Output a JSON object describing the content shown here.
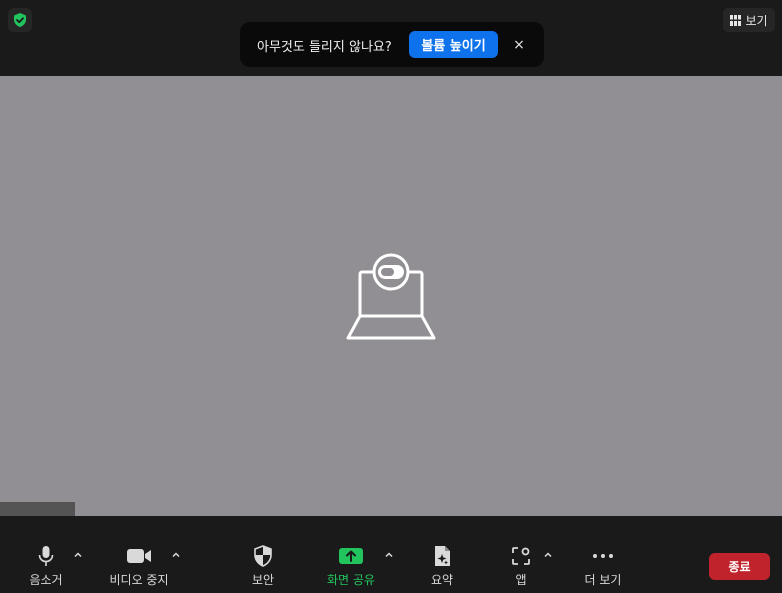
{
  "colors": {
    "accent_blue": "#0e72ed",
    "share_green": "#22c45e",
    "end_red": "#c0232c",
    "stage_gray": "#918f94",
    "security_green": "#22c45e"
  },
  "top": {
    "view_label": "보기",
    "view_icon": "grid-icon",
    "security_icon": "shield-check-icon"
  },
  "toast": {
    "message": "아무것도 들리지 않나요?",
    "action_label": "볼륨 높이기",
    "close_glyph": "×"
  },
  "stage": {
    "placeholder_icon": "laptop-camera-off-icon"
  },
  "toolbar": {
    "mute_label": "음소거",
    "video_label": "비디오 중지",
    "security_label": "보안",
    "share_label": "화면 공유",
    "summary_label": "요약",
    "apps_label": "앱",
    "more_label": "더 보기",
    "end_label": "종료"
  }
}
